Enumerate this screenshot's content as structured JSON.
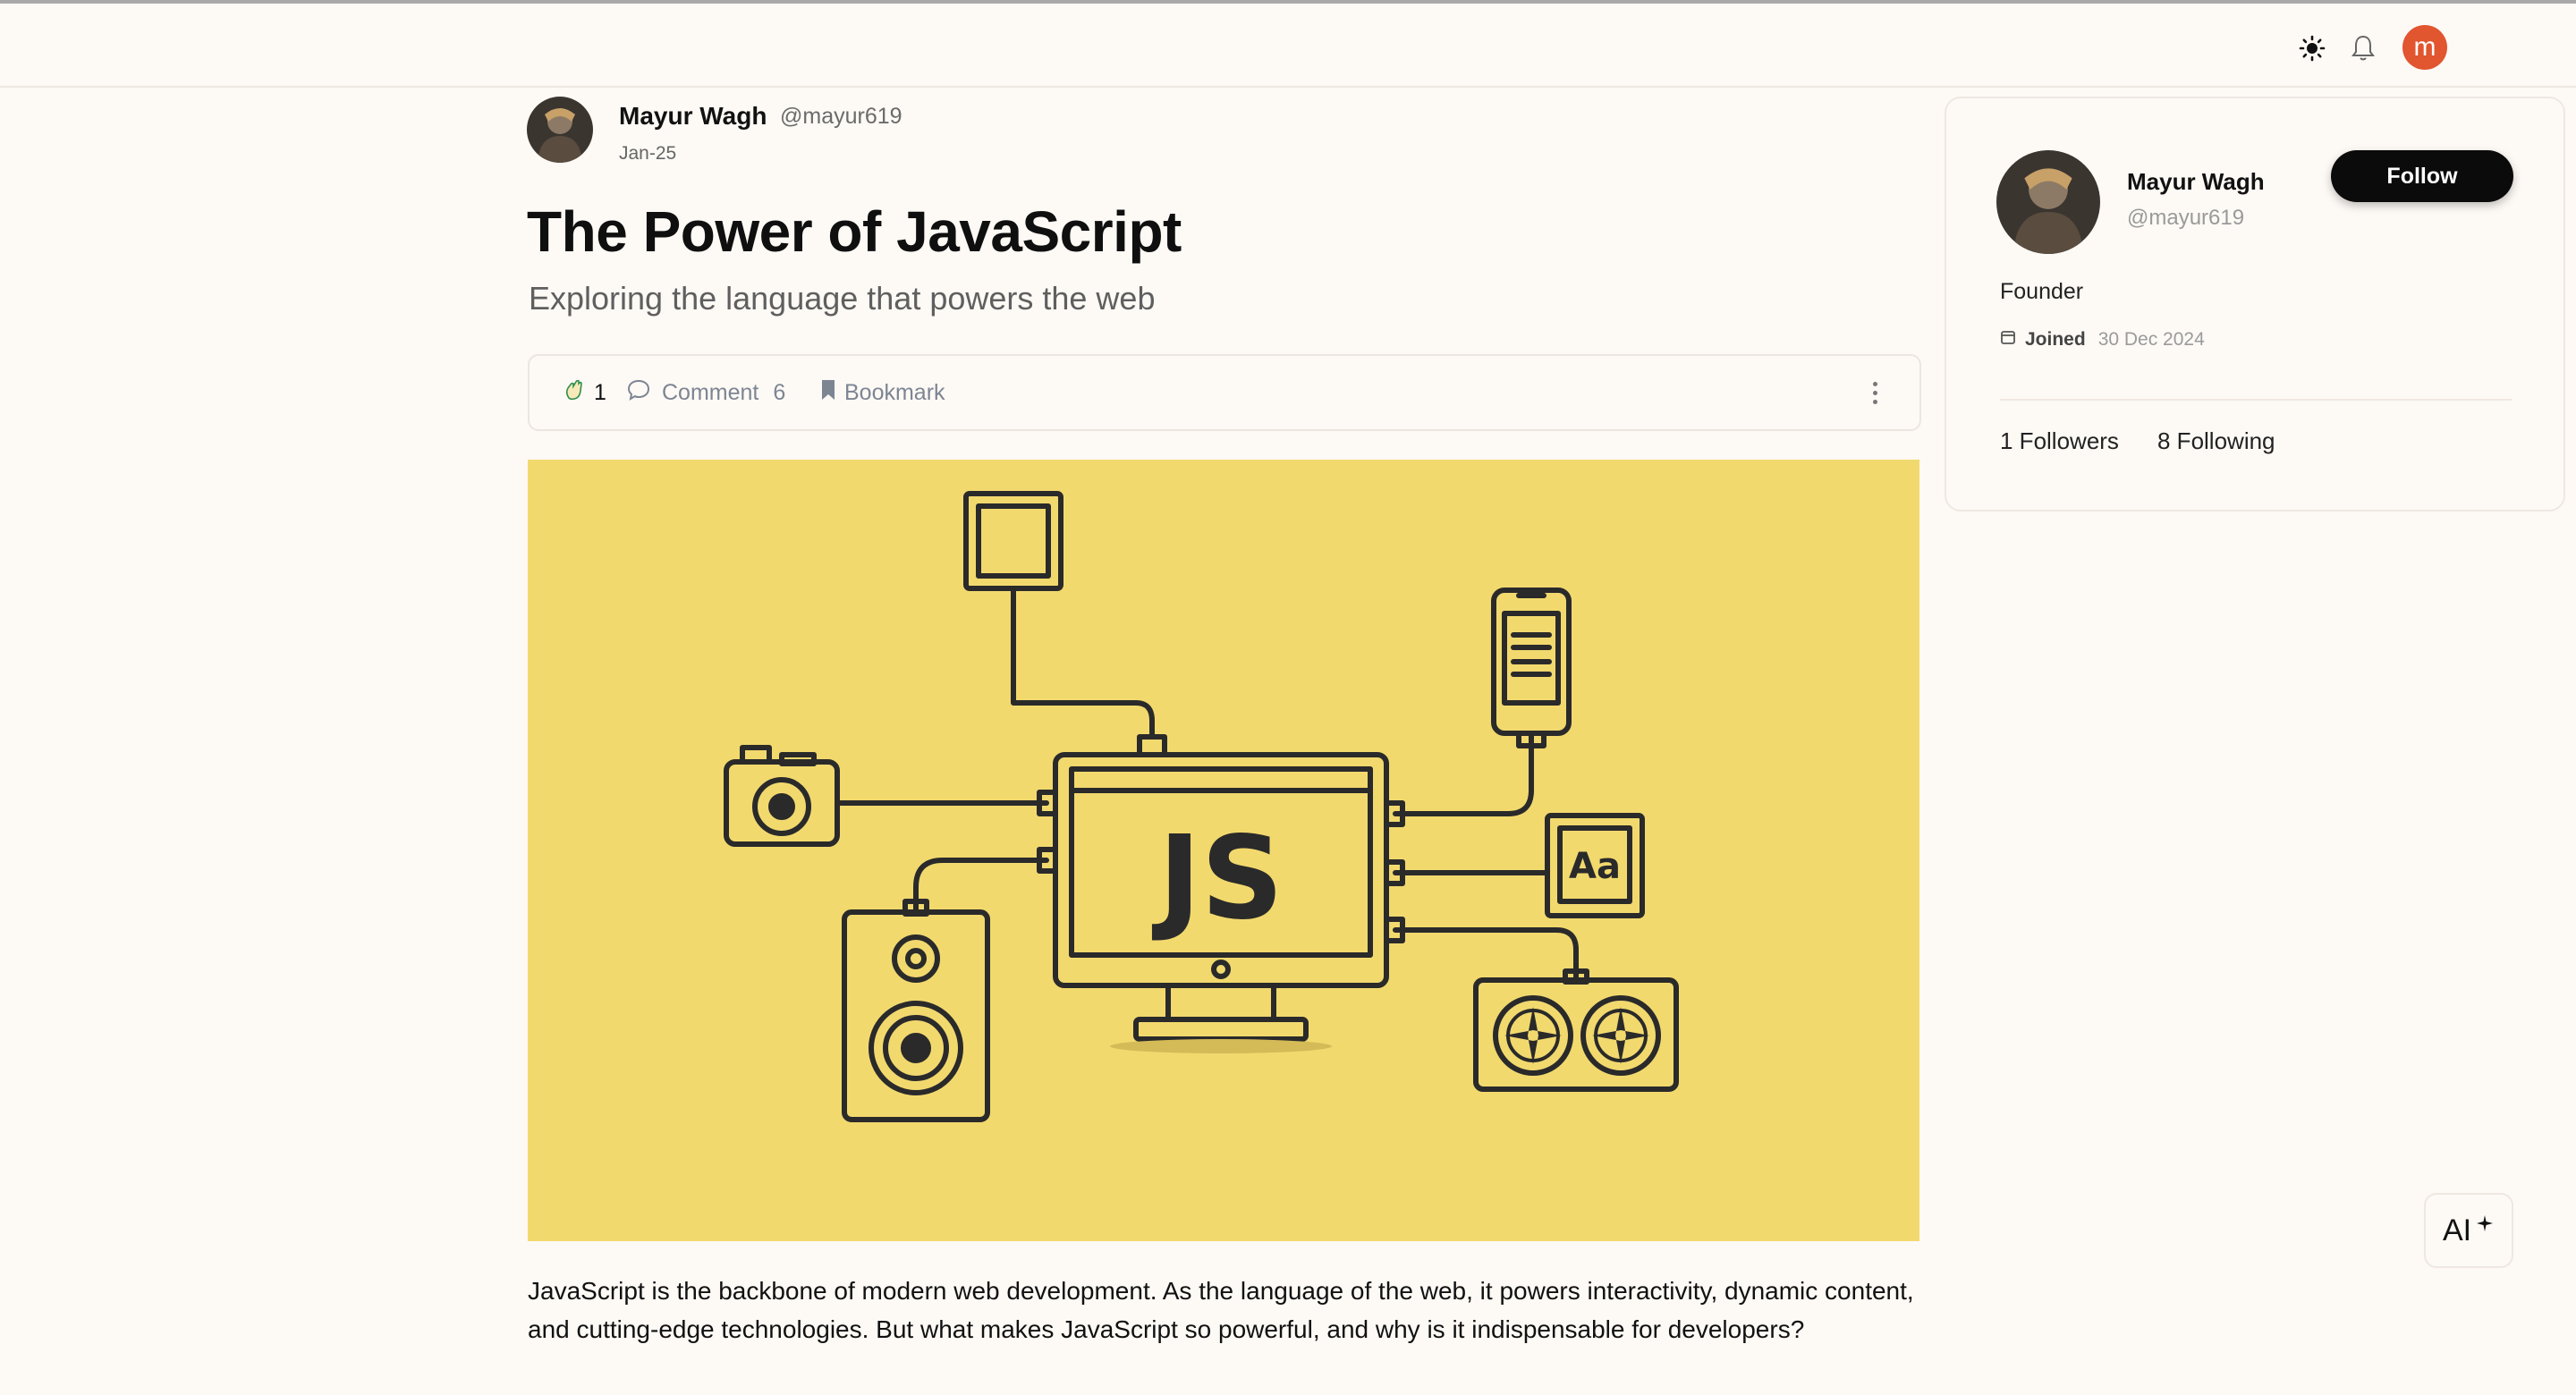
{
  "topbar": {
    "theme_icon": "sun-icon",
    "notification_icon": "bell-icon",
    "user_initial": "m"
  },
  "post": {
    "author_name": "Mayur Wagh",
    "author_handle": "@mayur619",
    "date": "Jan-25",
    "title": "The Power of JavaScript",
    "subtitle": "Exploring the language that powers the web",
    "actions": {
      "clap_count": "1",
      "comment_label": "Comment",
      "comment_count": "6",
      "bookmark_label": "Bookmark"
    },
    "hero_text": "JS",
    "hero_badge": "Aa",
    "body": "JavaScript is the backbone of modern web development. As the language of the web, it powers interactivity, dynamic content, and cutting-edge technologies. But what makes JavaScript so powerful, and why is it indispensable for developers?"
  },
  "profile": {
    "name": "Mayur Wagh",
    "handle": "@mayur619",
    "follow_label": "Follow",
    "bio": "Founder",
    "joined_label": "Joined",
    "joined_date": "30 Dec 2024",
    "followers": "1 Followers",
    "following": "8 Following"
  },
  "ai_button": {
    "label": "AI",
    "icon": "sparkle-icon"
  },
  "colors": {
    "background": "#fdf9f5",
    "hero_bg": "#f2d96e",
    "avatar_accent": "#e1552f",
    "follow_bg": "#0b0b0b"
  }
}
